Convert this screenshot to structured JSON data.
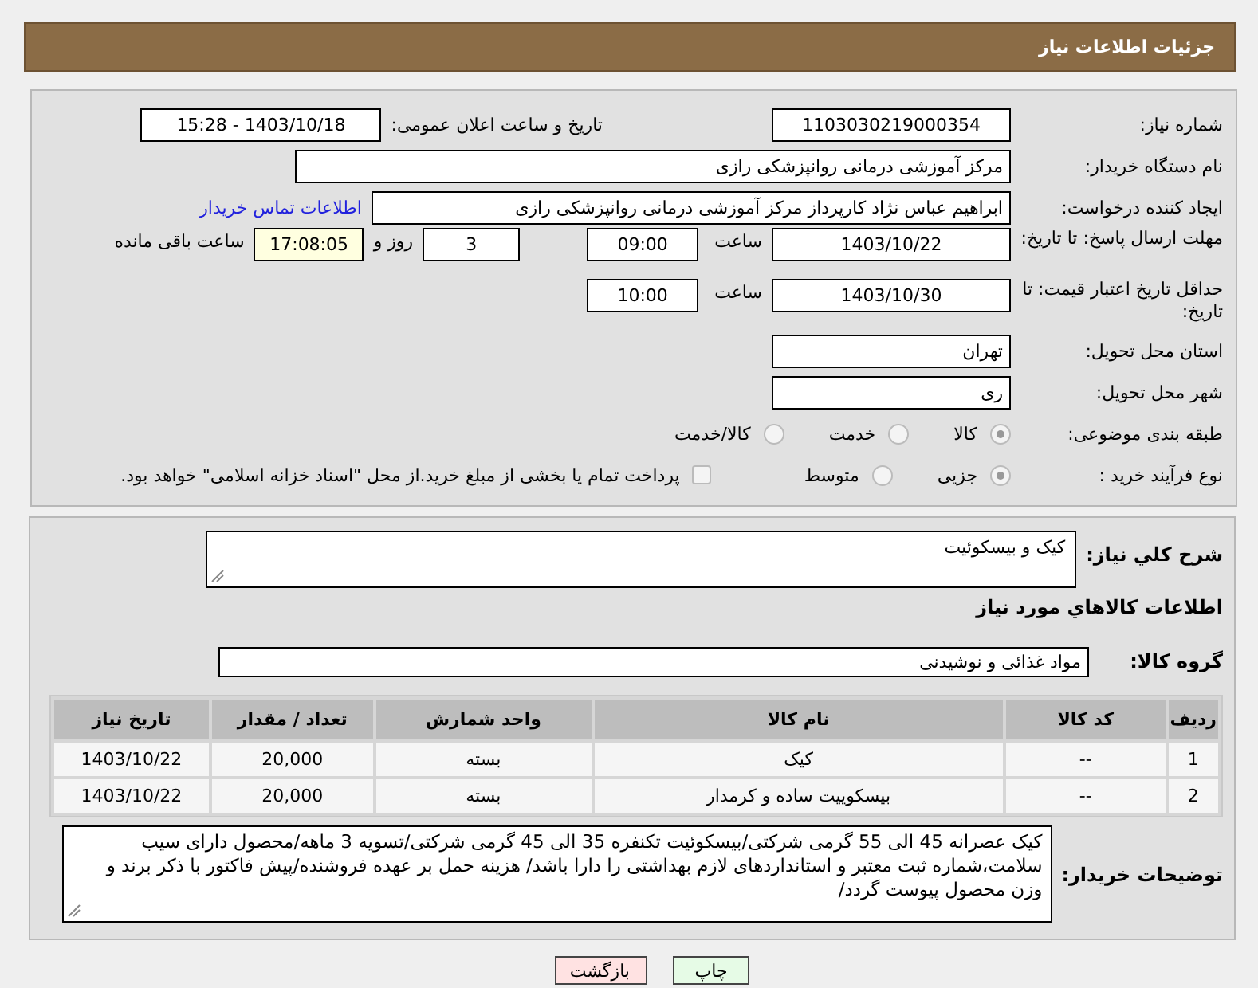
{
  "header": {
    "title": "جزئیات اطلاعات نیاز"
  },
  "need_info": {
    "need_number": {
      "label": "شماره نیاز:",
      "value": "1103030219000354"
    },
    "announce": {
      "label": "تاریخ و ساعت اعلان عمومی:",
      "value": "1403/10/18 - 15:28"
    },
    "buyer_org": {
      "label": "نام دستگاه خریدار:",
      "value": "مرکز آموزشی درمانی روانپزشکی رازی"
    },
    "requester": {
      "label": "ایجاد کننده درخواست:",
      "value": "ابراهیم عباس نژاد کارپرداز مرکز آموزشی درمانی روانپزشکی رازی",
      "link": "اطلاعات تماس خریدار"
    },
    "reply_deadline": {
      "label": "مهلت ارسال پاسخ: تا تاریخ:",
      "date": "1403/10/22",
      "time_label": "ساعت",
      "time": "09:00",
      "days": "3",
      "days_label": "روز و",
      "remaining": "17:08:05",
      "remaining_label": "ساعت باقی مانده"
    },
    "price_validity": {
      "label": "حداقل تاریخ اعتبار قیمت: تا تاریخ:",
      "date": "1403/10/30",
      "time_label": "ساعت",
      "time": "10:00"
    },
    "province": {
      "label": "استان محل تحویل:",
      "value": "تهران"
    },
    "city": {
      "label": "شهر محل تحویل:",
      "value": "ری"
    },
    "category": {
      "label": "طبقه بندی موضوعی:",
      "options": [
        {
          "label": "کالا",
          "selected": true
        },
        {
          "label": "خدمت",
          "selected": false
        },
        {
          "label": "کالا/خدمت",
          "selected": false
        }
      ]
    },
    "process": {
      "label": "نوع فرآیند خرید :",
      "options": [
        {
          "label": "جزیی",
          "selected": true
        },
        {
          "label": "متوسط",
          "selected": false
        }
      ],
      "treasury": {
        "checked": false,
        "label": "پرداخت تمام یا بخشی از مبلغ خرید.از محل \"اسناد خزانه اسلامی\" خواهد بود."
      }
    }
  },
  "items": {
    "summary": {
      "label": "شرح کلي نیاز:",
      "value": "کیک و بیسکوئیت"
    },
    "section_title": "اطلاعات کالاهاي مورد نیاز",
    "group": {
      "label": "گروه کالا:",
      "value": "مواد غذائی و نوشیدنی"
    },
    "table": {
      "columns": [
        "ردیف",
        "کد کالا",
        "نام کالا",
        "واحد شمارش",
        "تعداد / مقدار",
        "تاریخ نیاز"
      ],
      "rows": [
        [
          "1",
          "--",
          "کیک",
          "بسته",
          "20,000",
          "1403/10/22"
        ],
        [
          "2",
          "--",
          "بیسکوییت ساده و کرمدار",
          "بسته",
          "20,000",
          "1403/10/22"
        ]
      ]
    },
    "buyer_notes": {
      "label": "توضیحات خریدار:",
      "value": "کیک عصرانه 45 الی 55 گرمی شرکتی/بیسکوئیت تکنفره 35 الی 45 گرمی شرکتی/تسویه 3 ماهه/محصول دارای سیب سلامت،شماره ثبت معتبر و استانداردهای لازم بهداشتی را دارا باشد/ هزینه حمل بر عهده فروشنده/پیش فاکتور با ذکر برند و وزن محصول پیوست گردد/"
    }
  },
  "buttons": [
    {
      "label": "چاپ",
      "kind": "print"
    },
    {
      "label": "بازگشت",
      "kind": "back"
    }
  ]
}
